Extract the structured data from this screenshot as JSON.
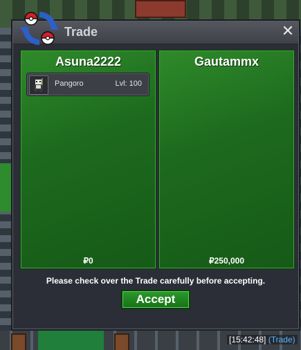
{
  "window": {
    "title": "Trade",
    "close_symbol": "✕"
  },
  "left_panel": {
    "player": "Asuna2222",
    "items": [
      {
        "name": "Pangoro",
        "level": "Lvl: 100",
        "icon": "pangoro-sprite-icon"
      }
    ],
    "money": "₽0"
  },
  "right_panel": {
    "player": "Gautammx",
    "money": "₽250,000"
  },
  "notice": "Please check over the Trade carefully before accepting.",
  "accept_label": "Accept",
  "chat": {
    "timestamp": "[15:42:48]",
    "channel": "(Trade)"
  },
  "colors": {
    "panel_green": "#1d6b1e",
    "accept_green": "#2c9a2c",
    "chat_tag": "#5fb5ff"
  }
}
